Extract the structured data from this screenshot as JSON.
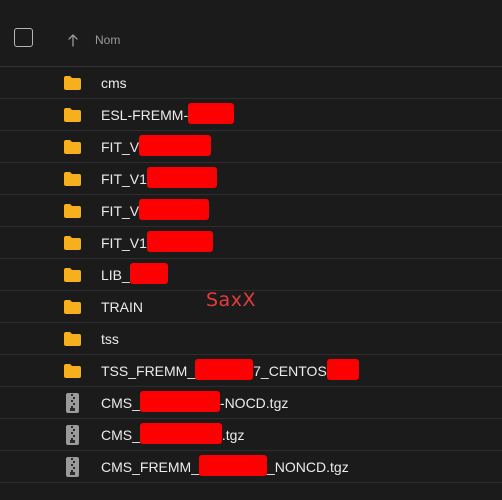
{
  "header": {
    "column_label": "Nom",
    "sort_icon": "arrow-up-icon",
    "select_all_icon": "checkbox-icon"
  },
  "colors": {
    "folder": "#f7b01b",
    "redaction": "#ff0000",
    "watermark": "#e53b3b",
    "background": "#1b1b1b"
  },
  "watermark": "SaxX",
  "rows": [
    {
      "type": "folder",
      "icon": "folder-icon",
      "parts": [
        "cms"
      ]
    },
    {
      "type": "folder",
      "icon": "folder-icon",
      "parts": [
        "ESL-FREMM-",
        "[redacted]"
      ]
    },
    {
      "type": "folder",
      "icon": "folder-icon",
      "parts": [
        "FIT_V",
        "[redacted]"
      ]
    },
    {
      "type": "folder",
      "icon": "folder-icon",
      "parts": [
        "FIT_V1",
        "[redacted]"
      ]
    },
    {
      "type": "folder",
      "icon": "folder-icon",
      "parts": [
        "FIT_V",
        "[redacted]"
      ]
    },
    {
      "type": "folder",
      "icon": "folder-icon",
      "parts": [
        "FIT_V1",
        "[redacted]"
      ]
    },
    {
      "type": "folder",
      "icon": "folder-icon",
      "parts": [
        "LIB_",
        "[redacted]"
      ]
    },
    {
      "type": "folder",
      "icon": "folder-icon",
      "parts": [
        "TRAIN"
      ]
    },
    {
      "type": "folder",
      "icon": "folder-icon",
      "parts": [
        "tss"
      ]
    },
    {
      "type": "folder",
      "icon": "folder-icon",
      "parts": [
        "TSS_FREMM_",
        "[redacted]",
        "7_CENTOS",
        "[redacted]"
      ]
    },
    {
      "type": "archive",
      "icon": "archive-file-icon",
      "parts": [
        "CMS_",
        "[redacted]",
        "-NOCD.tgz"
      ]
    },
    {
      "type": "archive",
      "icon": "archive-file-icon",
      "parts": [
        "CMS_",
        "[redacted]",
        ".tgz"
      ]
    },
    {
      "type": "archive",
      "icon": "archive-file-icon",
      "parts": [
        "CMS_FREMM_",
        "[redacted]",
        "_NONCD.tgz"
      ]
    }
  ]
}
